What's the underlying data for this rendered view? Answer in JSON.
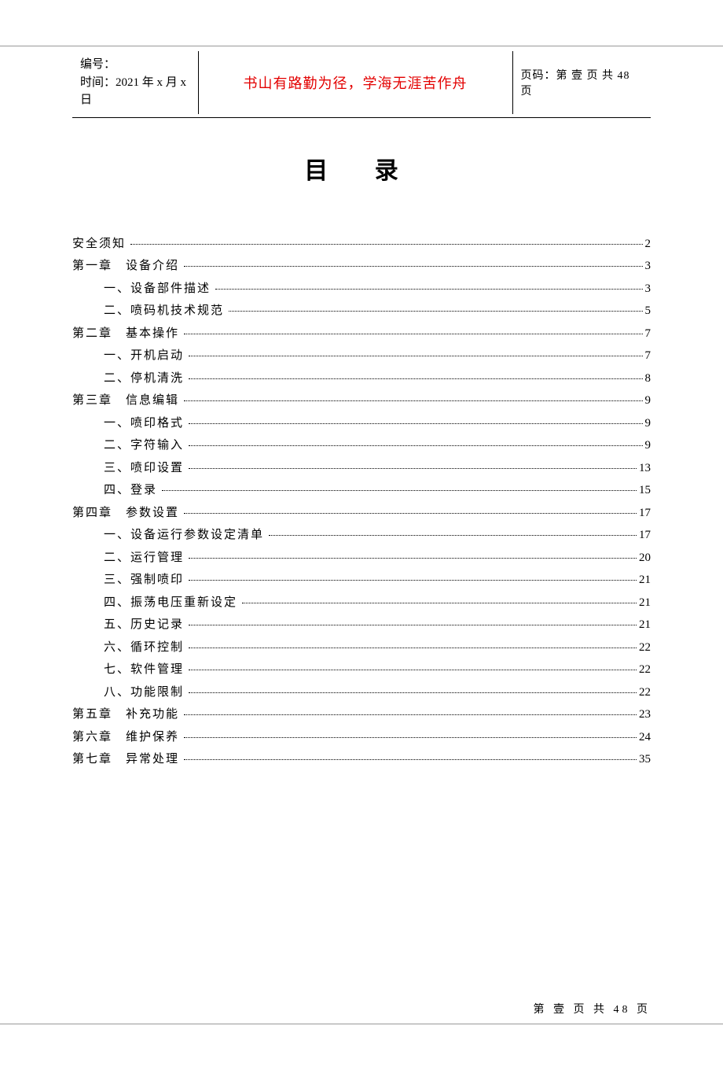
{
  "header": {
    "id_label": "编号：",
    "time_label": "时间：2021 年 x 月 x 日",
    "motto": "书山有路勤为径，学海无涯苦作舟",
    "page_label": "页码：第 壹 页  共 48 页"
  },
  "title": "目 录",
  "toc": [
    {
      "label": "安全须知",
      "page": "2",
      "level": 0
    },
    {
      "label": "第一章　设备介绍",
      "page": "3",
      "level": 0
    },
    {
      "label": "一、设备部件描述",
      "page": "3",
      "level": 1
    },
    {
      "label": "二、喷码机技术规范",
      "page": "5",
      "level": 1
    },
    {
      "label": "第二章　基本操作",
      "page": "7",
      "level": 0
    },
    {
      "label": "一、开机启动",
      "page": "7",
      "level": 1
    },
    {
      "label": "二、停机清洗",
      "page": "8",
      "level": 1
    },
    {
      "label": "第三章　信息编辑",
      "page": "9",
      "level": 0
    },
    {
      "label": "一、喷印格式",
      "page": "9",
      "level": 1
    },
    {
      "label": "二、字符输入",
      "page": "9",
      "level": 1
    },
    {
      "label": "三、喷印设置",
      "page": "13",
      "level": 1
    },
    {
      "label": "四、登录",
      "page": "15",
      "level": 1
    },
    {
      "label": "第四章　参数设置",
      "page": "17",
      "level": 0
    },
    {
      "label": "一、设备运行参数设定清单",
      "page": "17",
      "level": 1
    },
    {
      "label": "二、运行管理",
      "page": "20",
      "level": 1
    },
    {
      "label": "三、强制喷印",
      "page": "21",
      "level": 1
    },
    {
      "label": "四、振荡电压重新设定",
      "page": "21",
      "level": 1
    },
    {
      "label": "五、历史记录",
      "page": "21",
      "level": 1
    },
    {
      "label": "六、循环控制",
      "page": "22",
      "level": 1
    },
    {
      "label": "七、软件管理",
      "page": "22",
      "level": 1
    },
    {
      "label": "八、功能限制",
      "page": "22",
      "level": 1
    },
    {
      "label": "第五章　补充功能",
      "page": "23",
      "level": 0
    },
    {
      "label": "第六章　维护保养",
      "page": "24",
      "level": 0
    },
    {
      "label": "第七章　异常处理",
      "page": "35",
      "level": 0
    }
  ],
  "footer": "第 壹 页 共 48 页"
}
